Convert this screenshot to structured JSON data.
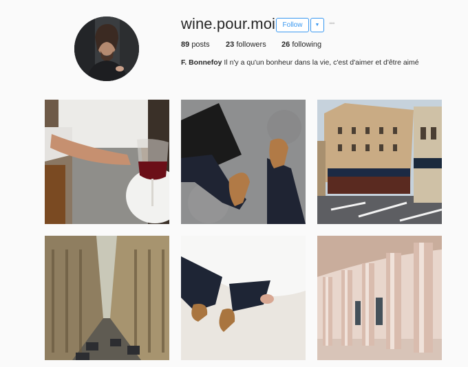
{
  "profile": {
    "username": "wine.pour.moi",
    "follow_label": "Follow",
    "dropdown_icon": "caret-down-icon",
    "more_icon": "more-options-icon",
    "more_glyph": "◦◦◦",
    "dropdown_glyph": "▼",
    "stats": {
      "posts_count": "89",
      "posts_label": "posts",
      "followers_count": "23",
      "followers_label": "followers",
      "following_count": "26",
      "following_label": "following"
    },
    "bio_name": "F. Bonnefoy",
    "bio_text": "Il n'y a qu'un bonheur dans la vie, c'est d'aimer et d'être aimé"
  },
  "posts": [
    {
      "subject": "man with red wine at cafe table"
    },
    {
      "subject": "feet in tan suede boots with black laptop bag"
    },
    {
      "subject": "parisian street corner with cafe"
    },
    {
      "subject": "narrow city street from above"
    },
    {
      "subject": "tan boots and white shirt from above"
    },
    {
      "subject": "pink classical colonnade"
    }
  ],
  "colors": {
    "accent": "#3897f0",
    "background": "#fafafa",
    "text": "#262626"
  }
}
